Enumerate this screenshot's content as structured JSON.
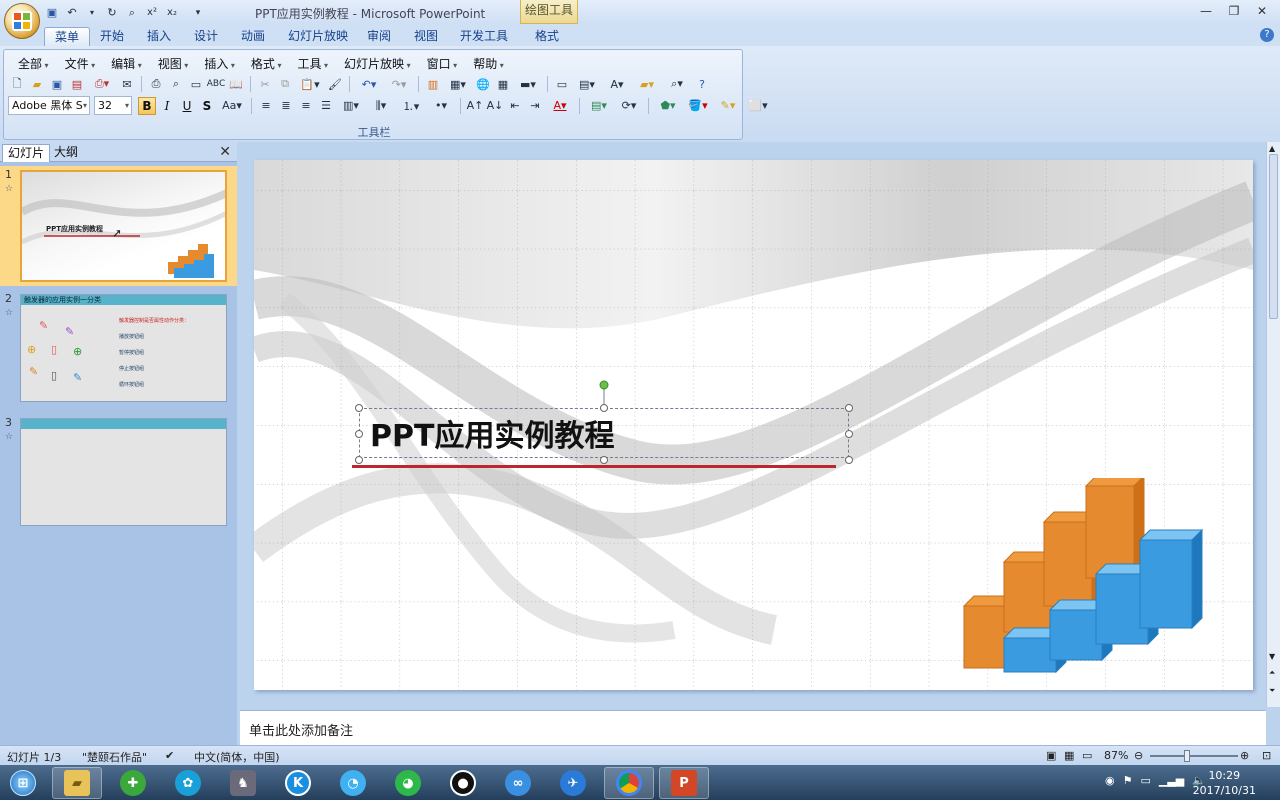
{
  "window": {
    "title": "PPT应用实例教程 - Microsoft PowerPoint",
    "context_group": "绘图工具"
  },
  "ribbon_tabs": [
    "菜单",
    "开始",
    "插入",
    "设计",
    "动画",
    "幻灯片放映",
    "审阅",
    "视图",
    "开发工具",
    "格式"
  ],
  "menu": [
    "全部",
    "文件",
    "编辑",
    "视图",
    "插入",
    "格式",
    "工具",
    "幻灯片放映",
    "窗口",
    "帮助"
  ],
  "toolbar": {
    "font_name": "Adobe 黑体 S",
    "font_size": "32",
    "group_label": "工具栏"
  },
  "pane": {
    "tabs": [
      "幻灯片",
      "大纲"
    ]
  },
  "thumbnails": {
    "t1": {
      "num": "1",
      "title": "PPT应用实例教程"
    },
    "t2": {
      "num": "2",
      "header": "触发器的应用实例一分类",
      "lines": [
        "触发器控制是否属性动作分类：",
        "播放按钮组",
        "暂停按钮组",
        "停止按钮组",
        "循环按钮组"
      ]
    },
    "t3": {
      "num": "3"
    }
  },
  "slide": {
    "title": "PPT应用实例教程"
  },
  "notes": {
    "placeholder": "单击此处添加备注"
  },
  "status": {
    "slide_info": "幻灯片 1/3",
    "theme": "\"楚颐石作品\"",
    "language": "中文(简体，中国)",
    "zoom": "87%"
  },
  "taskbar": {
    "time": "10:29",
    "date": "2017/10/31"
  },
  "colors": {
    "accent_orange": "#f0a23a",
    "accent_blue": "#3b9be0",
    "title_underline": "#b8282c",
    "ribbon_bg": "#dfeaf8"
  }
}
